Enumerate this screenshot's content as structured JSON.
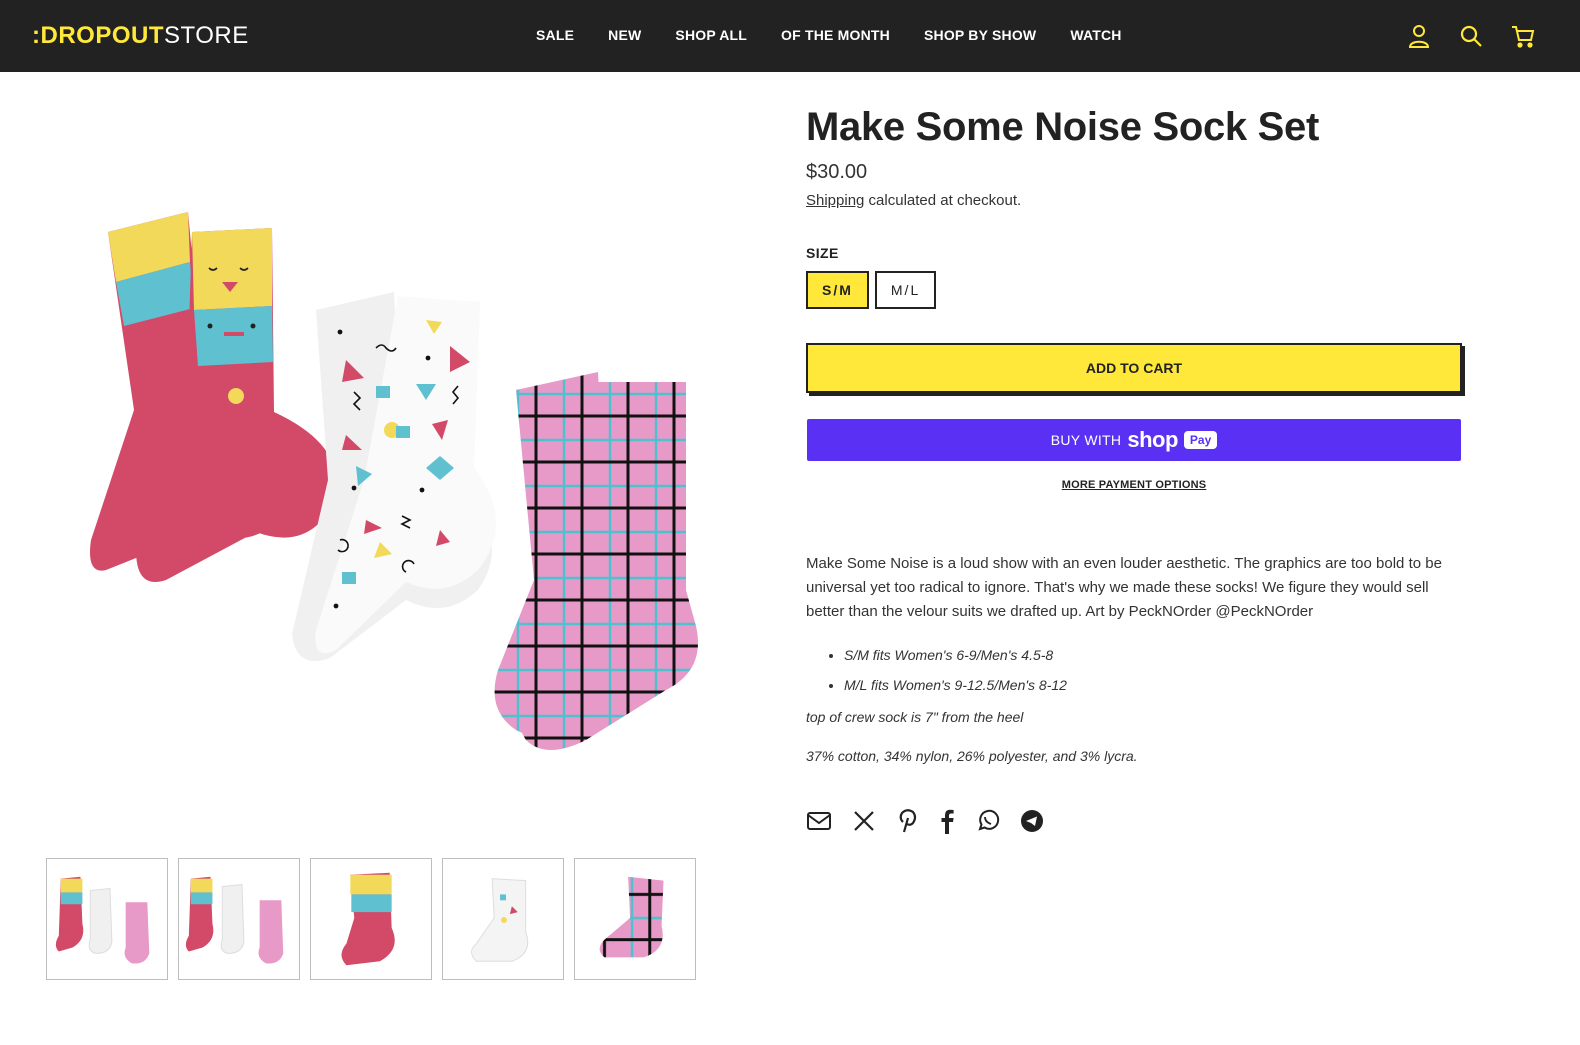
{
  "header": {
    "logo_prefix": ":DROPOUT",
    "logo_suffix": "STORE",
    "nav": [
      "SALE",
      "NEW",
      "SHOP ALL",
      "OF THE MONTH",
      "SHOP BY SHOW",
      "WATCH"
    ],
    "icons": [
      "account-icon",
      "search-icon",
      "cart-icon"
    ],
    "accent_color": "#ffe83a",
    "bar_color": "#222222"
  },
  "product": {
    "title": "Make Some Noise Sock Set",
    "price": "$30.00",
    "shipping_link": "Shipping",
    "shipping_text": " calculated at checkout.",
    "size_label": "SIZE",
    "sizes": [
      "S/M",
      "M/L"
    ],
    "selected_size": "S/M",
    "add_to_cart": "ADD TO CART",
    "shoppay": {
      "buy_with": "BUY WITH",
      "brand": "shop",
      "pay": "Pay",
      "color": "#5a31f4"
    },
    "more_payment": "MORE PAYMENT OPTIONS",
    "description": "Make Some Noise is a loud show with an even louder aesthetic. The graphics are too bold to be universal yet too radical to ignore. That's why we made these socks! We figure they would sell better than the velour suits we drafted up. Art by PeckNOrder @PeckNOrder",
    "bullets": [
      "S/M fits Women's 6-9/Men's 4.5-8",
      "M/L fits Women's 9-12.5/Men's 8-12"
    ],
    "note_height": "top of crew sock is 7\" from the heel",
    "note_material": "37% cotton, 34% nylon, 26% polyester, and 3% lycra."
  },
  "gallery": {
    "thumb_count": 5
  },
  "share": [
    "email-icon",
    "x-icon",
    "pinterest-icon",
    "facebook-icon",
    "whatsapp-icon",
    "telegram-icon"
  ]
}
